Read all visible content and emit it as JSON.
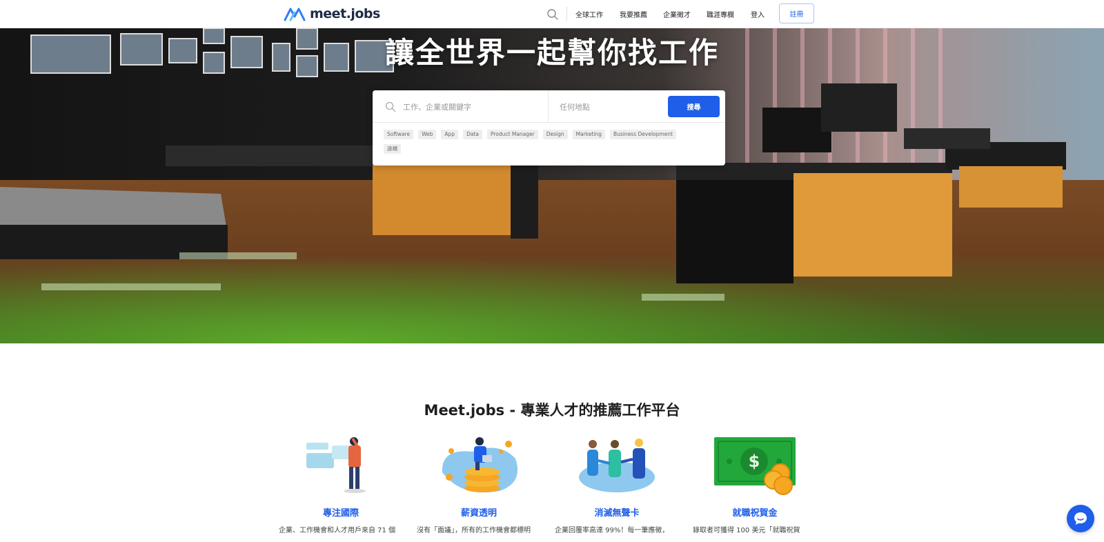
{
  "header": {
    "logo_text": "meet.jobs",
    "nav": [
      "全球工作",
      "我要推薦",
      "企業徵才",
      "職涯專欄",
      "登入"
    ],
    "register_label": "註冊"
  },
  "hero": {
    "title": "讓全世界一起幫你找工作",
    "keyword_placeholder": "工作、企業或關鍵字",
    "location_placeholder": "任何地點",
    "search_label": "搜尋",
    "tags": [
      "Software",
      "Web",
      "App",
      "Data",
      "Product Manager",
      "Design",
      "Marketing",
      "Business Development",
      "遠端"
    ]
  },
  "features_section": {
    "title": "Meet.jobs - 專業人才的推薦工作平台",
    "items": [
      {
        "title": "專注國際",
        "desc": "企業、工作機會和人才用戶來自 71 個"
      },
      {
        "title": "薪資透明",
        "desc": "沒有「面議」，所有的工作機會都標明"
      },
      {
        "title": "消滅無聲卡",
        "desc": "企業回覆率高達 99%！每一筆應徵，"
      },
      {
        "title": "就職祝賀金",
        "desc": "錄取者可獲得 100 美元「就職祝賀"
      }
    ]
  },
  "colors": {
    "accent": "#1f5ee8",
    "text": "#1e1e1e",
    "tag_bg": "#eeeeee"
  },
  "icons": [
    "meet-jobs-logo",
    "search-icon",
    "chat-icon"
  ]
}
